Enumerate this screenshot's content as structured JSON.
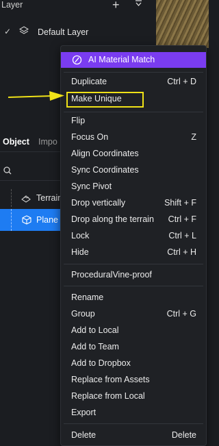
{
  "layer_panel": {
    "title": "Layer",
    "add_icon": "plus",
    "menu_icon": "chevron-down",
    "default_layer": "Default Layer"
  },
  "object_panel": {
    "tabs": [
      "Object",
      "Impo"
    ],
    "tree": [
      {
        "label": "Terrain",
        "icon": "terrain-icon"
      },
      {
        "label": "Plane",
        "icon": "cube-icon",
        "selected": true
      }
    ]
  },
  "context_menu": {
    "ai_button": "AI Material Match",
    "groups": [
      [
        {
          "label": "Duplicate",
          "shortcut": "Ctrl + D"
        },
        {
          "label": "Make Unique",
          "shortcut": ""
        }
      ],
      [
        {
          "label": "Flip",
          "shortcut": ""
        },
        {
          "label": "Focus On",
          "shortcut": "Z"
        },
        {
          "label": "Align Coordinates",
          "shortcut": ""
        },
        {
          "label": "Sync Coordinates",
          "shortcut": ""
        },
        {
          "label": "Sync Pivot",
          "shortcut": ""
        },
        {
          "label": "Drop vertically",
          "shortcut": "Shift + F"
        },
        {
          "label": "Drop along the terrain",
          "shortcut": "Ctrl + F"
        },
        {
          "label": "Lock",
          "shortcut": "Ctrl + L"
        },
        {
          "label": "Hide",
          "shortcut": "Ctrl + H"
        }
      ],
      [
        {
          "label": "ProceduralVine-proof",
          "shortcut": ""
        }
      ],
      [
        {
          "label": "Rename",
          "shortcut": ""
        },
        {
          "label": "Group",
          "shortcut": "Ctrl + G"
        },
        {
          "label": "Add to Local",
          "shortcut": ""
        },
        {
          "label": "Add to Team",
          "shortcut": ""
        },
        {
          "label": "Add to Dropbox",
          "shortcut": ""
        },
        {
          "label": "Replace from Assets",
          "shortcut": ""
        },
        {
          "label": "Replace from Local",
          "shortcut": ""
        },
        {
          "label": "Export",
          "shortcut": ""
        }
      ],
      [
        {
          "label": "Delete",
          "shortcut": "Delete"
        }
      ]
    ]
  },
  "annotation": {
    "highlight_color": "#f0e218",
    "highlighted_item": "Make Unique"
  },
  "colors": {
    "ai_purple": "#7a3cf0",
    "selection_blue": "#1e7cf2",
    "menu_bg": "#1f2125"
  }
}
